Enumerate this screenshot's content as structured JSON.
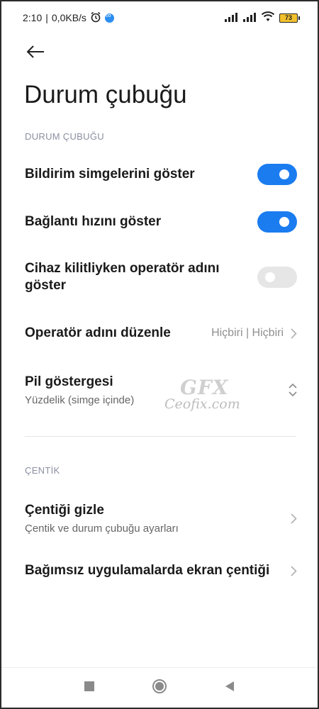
{
  "status_bar": {
    "time": "2:10",
    "speed": "0,0KB/s",
    "battery_level": "73"
  },
  "header": {
    "back_icon": "arrow-left-icon",
    "title": "Durum çubuğu"
  },
  "sections": {
    "status_bar_section": {
      "header": "DURUM ÇUBUĞU",
      "items": [
        {
          "label": "Bildirim simgelerini göster",
          "toggle": true
        },
        {
          "label": "Bağlantı hızını göster",
          "toggle": true
        },
        {
          "label": "Cihaz kilitliyken operatör adını göster",
          "toggle": false
        },
        {
          "label": "Operatör adını düzenle",
          "value": "Hiçbiri | Hiçbiri"
        },
        {
          "label": "Pil göstergesi",
          "sub": "Yüzdelik (simge içinde)"
        }
      ]
    },
    "notch_section": {
      "header": "ÇENTİK",
      "items": [
        {
          "label": "Çentiği gizle",
          "sub": "Çentik ve durum çubuğu ayarları"
        },
        {
          "label": "Bağımsız uygulamalarda ekran çentiği"
        }
      ]
    }
  },
  "watermark": {
    "logo": "GFX",
    "text": "Ceofix.com"
  },
  "colors": {
    "accent": "#1b7cf0",
    "toggle_off": "#e6e6e6",
    "section_header": "#8a8fa0"
  }
}
